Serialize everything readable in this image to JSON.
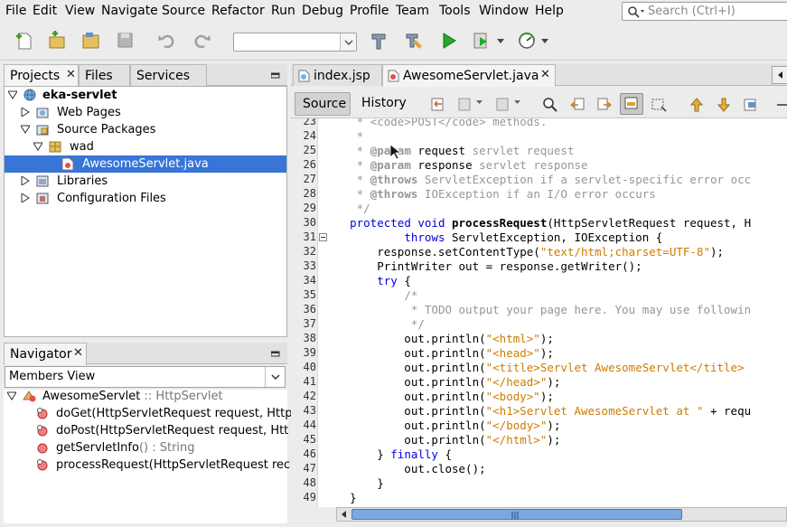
{
  "menu": [
    "File",
    "Edit",
    "View",
    "Navigate",
    "Source",
    "Refactor",
    "Run",
    "Debug",
    "Profile",
    "Team",
    "Tools",
    "Window",
    "Help"
  ],
  "search": {
    "placeholder": "Search (Ctrl+I)"
  },
  "left_tabs": {
    "projects": "Projects",
    "files": "Files",
    "services": "Services"
  },
  "project_tree": {
    "root": "eka-servlet",
    "web_pages": "Web Pages",
    "source_packages": "Source Packages",
    "package": "wad",
    "file": "AwesomeServlet.java",
    "libraries": "Libraries",
    "config": "Configuration Files"
  },
  "navigator": {
    "title": "Navigator",
    "view": "Members View",
    "class_name": "AwesomeServlet",
    "class_super": " :: HttpServlet",
    "members": [
      {
        "name": "doGet",
        "sig": "(HttpServletRequest request, Http"
      },
      {
        "name": "doPost",
        "sig": "(HttpServletRequest request, Htt"
      },
      {
        "name": "getServletInfo",
        "sig": "() : String"
      },
      {
        "name": "processRequest",
        "sig": "(HttpServletRequest rec"
      }
    ]
  },
  "editor_tabs": [
    "index.jsp",
    "AwesomeServlet.java"
  ],
  "editor_toolbar": {
    "source": "Source",
    "history": "History"
  },
  "code_lines": [
    {
      "n": "23",
      "html": "     <span class='cm'>* &lt;code&gt;POST&lt;/code&gt; methods.</span>"
    },
    {
      "n": "24",
      "html": "     <span class='cm'>*</span>"
    },
    {
      "n": "25",
      "html": "     <span class='cm'>* <b>@param</b></span> request <span class='cm'>servlet request</span>"
    },
    {
      "n": "26",
      "html": "     <span class='cm'>* <b>@param</b></span> response <span class='cm'>servlet response</span>"
    },
    {
      "n": "27",
      "html": "     <span class='cm'>* <b>@throws</b> ServletException if a servlet-specific error occ</span>"
    },
    {
      "n": "28",
      "html": "     <span class='cm'>* <b>@throws</b> IOException if an I/O error occurs</span>"
    },
    {
      "n": "29",
      "html": "     <span class='cm'>*/</span>"
    },
    {
      "n": "30",
      "html": "    <span class='kw'>protected void</span> <b>processRequest</b>(HttpServletRequest request, H"
    },
    {
      "n": "31",
      "html": "            <span class='kw'>throws</span> ServletException, IOException {"
    },
    {
      "n": "32",
      "html": "        response.setContentType(<span class='str'>\"text/html;charset=UTF-8\"</span>);"
    },
    {
      "n": "33",
      "html": "        PrintWriter out = response.getWriter();"
    },
    {
      "n": "34",
      "html": "        <span class='kw'>try</span> {"
    },
    {
      "n": "35",
      "html": "            <span class='cm'>/*</span>"
    },
    {
      "n": "36",
      "html": "             <span class='cm'>* TODO output your page here. You may use followin</span>"
    },
    {
      "n": "37",
      "html": "             <span class='cm'>*/</span>"
    },
    {
      "n": "38",
      "html": "            out.println(<span class='str'>\"&lt;html&gt;\"</span>);"
    },
    {
      "n": "39",
      "html": "            out.println(<span class='str'>\"&lt;head&gt;\"</span>);"
    },
    {
      "n": "40",
      "html": "            out.println(<span class='str'>\"&lt;title&gt;Servlet AwesomeServlet&lt;/title&gt;</span>"
    },
    {
      "n": "41",
      "html": "            out.println(<span class='str'>\"&lt;/head&gt;\"</span>);"
    },
    {
      "n": "42",
      "html": "            out.println(<span class='str'>\"&lt;body&gt;\"</span>);"
    },
    {
      "n": "43",
      "html": "            out.println(<span class='str'>\"&lt;h1&gt;Servlet AwesomeServlet at \"</span> + requ"
    },
    {
      "n": "44",
      "html": "            out.println(<span class='str'>\"&lt;/body&gt;\"</span>);"
    },
    {
      "n": "45",
      "html": "            out.println(<span class='str'>\"&lt;/html&gt;\"</span>);"
    },
    {
      "n": "46",
      "html": "        } <span class='kw'>finally</span> {"
    },
    {
      "n": "47",
      "html": "            out.close();"
    },
    {
      "n": "48",
      "html": "        }"
    },
    {
      "n": "49",
      "html": "    }"
    }
  ],
  "colors": {
    "selection": "#3875d7",
    "keyword": "#0000e6",
    "string": "#ce7b00",
    "comment": "#969696"
  }
}
